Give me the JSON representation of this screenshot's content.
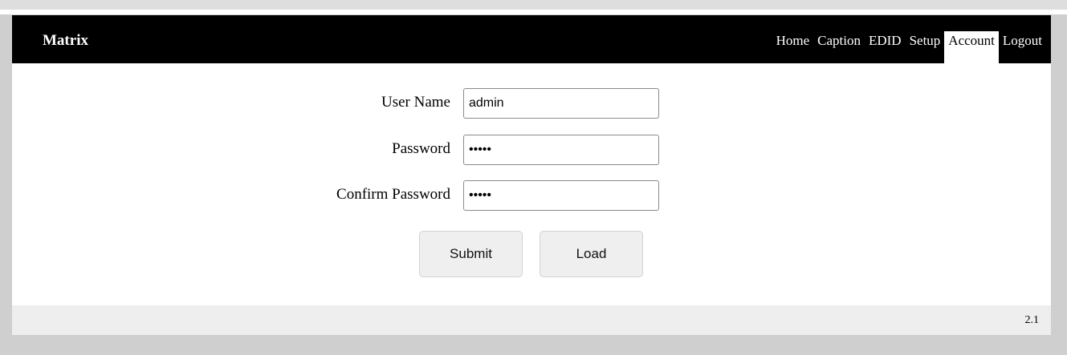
{
  "header": {
    "brand": "Matrix",
    "nav": [
      {
        "label": "Home"
      },
      {
        "label": "Caption"
      },
      {
        "label": "EDID"
      },
      {
        "label": "Setup"
      },
      {
        "label": "Account",
        "active": true
      },
      {
        "label": "Logout"
      }
    ]
  },
  "form": {
    "username": {
      "label": "User Name",
      "value": "admin"
    },
    "password": {
      "label": "Password",
      "value": "•••••"
    },
    "confirm_password": {
      "label": "Confirm Password",
      "value": "•••••"
    }
  },
  "buttons": {
    "submit": "Submit",
    "load": "Load"
  },
  "footer": {
    "version": "2.1"
  },
  "colors": {
    "navbar": "#000000",
    "active_tab_bg": "#ffffff",
    "frame": "#cfcfcf",
    "footer": "#eeeeee",
    "button": "#efefef"
  }
}
